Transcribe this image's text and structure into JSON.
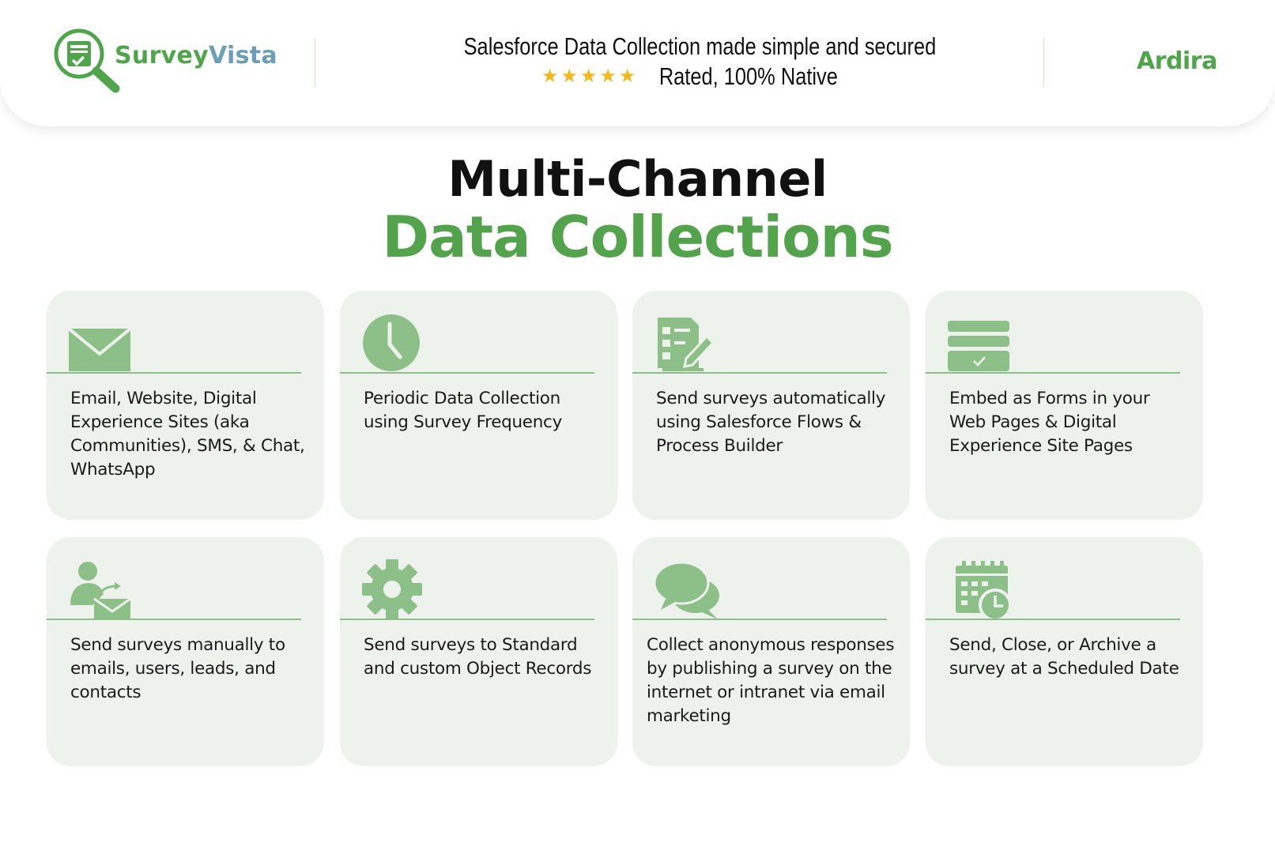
{
  "header": {
    "brand_part1": "Survey",
    "brand_part2": "Vista",
    "tagline_line1": "Salesforce Data Collection made simple and secured",
    "stars": "★★★★★",
    "rating_text": "Rated, 100% Native",
    "partner_logo": "Ardira"
  },
  "title": {
    "line1": "Multi-Channel",
    "line2": "Data Collections"
  },
  "cards": [
    {
      "icon": "envelope-icon",
      "text": "Email, Website, Digital Experience Sites (aka Communities), SMS, & Chat, WhatsApp"
    },
    {
      "icon": "clock-icon",
      "text": "Periodic Data Collection using Survey Frequency"
    },
    {
      "icon": "checklist-pencil-icon",
      "text": "Send surveys automatically using Salesforce Flows & Process Builder"
    },
    {
      "icon": "embedded-form-icon",
      "text": "Embed as Forms in your Web Pages & Digital Experience Site Pages"
    },
    {
      "icon": "user-send-mail-icon",
      "text": "Send surveys manually to emails, users, leads, and contacts"
    },
    {
      "icon": "gear-icon",
      "text": "Send surveys to Standard and custom Object Records"
    },
    {
      "icon": "chat-bubbles-icon",
      "text": "Collect anonymous responses by publishing a survey on the internet or intranet via email marketing"
    },
    {
      "icon": "calendar-clock-icon",
      "text": "Send, Close, or Archive a survey at a Scheduled Date"
    }
  ],
  "colors": {
    "brand_green": "#52a34c",
    "brand_blue": "#6a9fb5",
    "card_bg": "#edf3ec",
    "icon_green": "#8cc088",
    "star": "#f5b818"
  }
}
